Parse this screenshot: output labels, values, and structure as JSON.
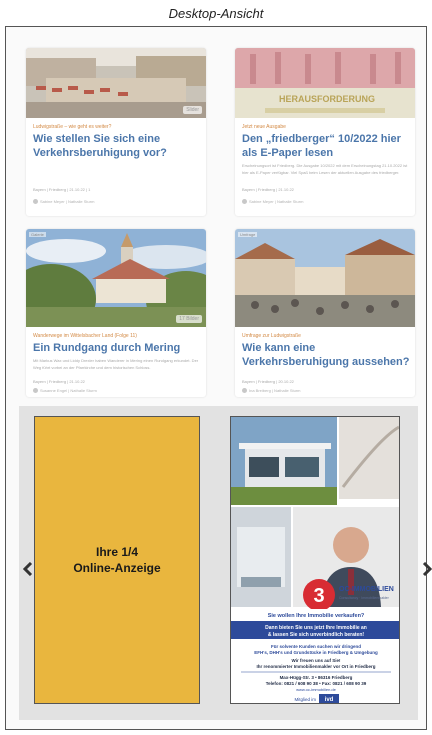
{
  "caption": "Desktop-Ansicht",
  "cards": [
    {
      "kicker": "Ludwigstraße – wie geht es weiter?",
      "title": "Wie stellen Sie sich eine Verkehrsberuhigung vor?",
      "excerpt": "",
      "meta": "Bayern  |  Friedberg  |  21.10.22  |  1",
      "author": "Sabine Meyer  |  Nathalie Sturm",
      "badge": "Slider"
    },
    {
      "kicker": "Jetzt neue Ausgabe",
      "title": "Den „friedberger“ 10/2022 hier als E-Paper lesen",
      "excerpt": "Erscheinungsort ist Friedberg. Die Ausgabe 10/2022 mit dem Erscheinungstag 21.10.2022 ist hier als E-Paper verfügbar. Viel Spaß beim Lesen der aktuellen Ausgabe des friedberger.",
      "meta": "Bayern  |  Friedberg  |  21.10.22",
      "author": "Sabine Meyer  |  Nathalie Sturm",
      "image_text": "HERAUSFORDERUNG"
    },
    {
      "kicker": "Wanderwege im Wittelsbacher Land (Folge 11)",
      "title": "Ein Rundgang durch Mering",
      "excerpt": "Mit Markus Wax und Liddy Drexler haben Wanderer in Mering einen Rundgang erkundet. Der Weg führt vorbei an der Pfarrkirche und dem historischen Schloss.",
      "meta": "Bayern  |  Friedberg  |  21.10.22",
      "author": "Susanne Engel  |  Nathalie Sturm",
      "badge": "17 Bilder",
      "tag": "Galerie"
    },
    {
      "kicker": "Umfrage zur Ludwigstraße",
      "title": "Wie kann eine Verkehrsberuhigung aussehen?",
      "excerpt": "",
      "meta": "Bayern  |  Friedberg  |  20.10.22",
      "author": "Ina Breiberg  |  Nathalie Sturm",
      "tag": "Umfrage"
    }
  ],
  "ad_placeholder": {
    "line1": "Ihre 1/4",
    "line2": "Online-Anzeige"
  },
  "ad_real": {
    "number": "3",
    "brand": "OC-IMMOBILIEN",
    "brand_sub": "Consultancy · Immobilienmakler",
    "question": "Sie wollen Ihre Immobilie verkaufen?",
    "red_band_1": "Dann bieten Sie uns jetzt Ihre Immobilie an",
    "red_band_2": "& lassen Sie sich unverbindlich beraten!",
    "white_1": "Für solvente Kunden suchen wir dringend",
    "white_2": "EFH's, DHH's und Grundstücke in Friedberg & Umgebung",
    "white_3": "Wir freuen uns auf Sie!",
    "white_4": "Ihr renommierter Immobilienmakler vor Ort in Friedberg",
    "address_1": "Max-Hügg-Str. 3 • 86316 Friedberg",
    "address_2": "Telefon: 0821 / 608 90 38 • Fax: 0821 / 608 90 39",
    "address_3": "www.oc-immobilien.de",
    "member": "Mitglied im",
    "member_logo": "ivd"
  },
  "colors": {
    "title_blue": "#4b76aa",
    "kicker_orange": "#d38a45",
    "ad_yellow": "#e9b63e",
    "band_blue": "#2d4a9a",
    "number_red": "#d82c33"
  }
}
